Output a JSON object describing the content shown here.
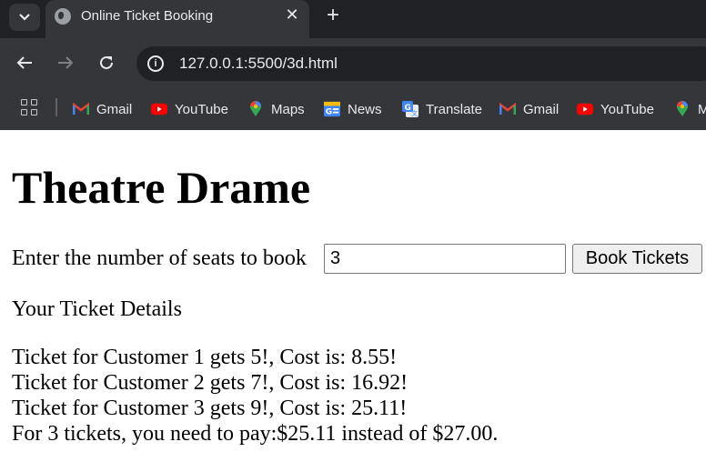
{
  "browser": {
    "tab_title": "Online Ticket Booking",
    "tab_close_glyph": "✕",
    "new_tab_glyph": "+",
    "url": "127.0.0.1:5500/3d.html",
    "info_glyph": "i",
    "bookmarks": [
      {
        "label": "Gmail",
        "icon": "gmail-icon"
      },
      {
        "label": "YouTube",
        "icon": "youtube-icon"
      },
      {
        "label": "Maps",
        "icon": "maps-icon"
      },
      {
        "label": "News",
        "icon": "news-icon"
      },
      {
        "label": "Translate",
        "icon": "translate-icon"
      },
      {
        "label": "Gmail",
        "icon": "gmail-icon"
      },
      {
        "label": "YouTube",
        "icon": "youtube-icon"
      },
      {
        "label": "M",
        "icon": "maps-icon"
      }
    ],
    "colors": {
      "chrome_dark": "#202124",
      "chrome": "#35363a",
      "text": "#e8eaed"
    }
  },
  "page": {
    "title": "Theatre Drame",
    "seat_label": "Enter the number of seats to book",
    "seat_value": "3",
    "book_button": "Book Tickets",
    "details_title": "Your Ticket Details",
    "details": [
      "Ticket for Customer 1 gets 5!, Cost is: 8.55!",
      "Ticket for Customer 2 gets 7!, Cost is: 16.92!",
      "Ticket for Customer 3 gets 9!, Cost is: 25.11!",
      "For 3 tickets, you need to pay:$25.11 instead of $27.00."
    ]
  }
}
